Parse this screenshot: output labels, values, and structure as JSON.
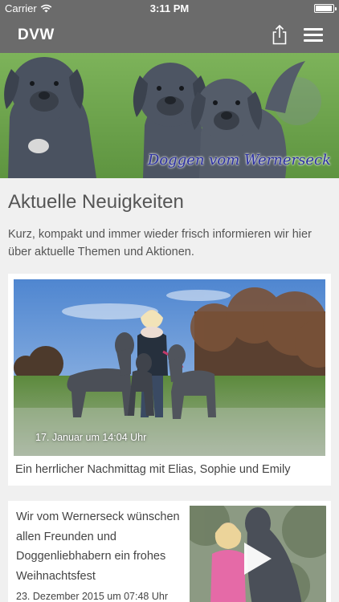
{
  "status_bar": {
    "carrier": "Carrier",
    "time": "3:11 PM",
    "battery_level": 0.95
  },
  "nav": {
    "title": "DVW",
    "share_icon": "share-icon",
    "menu_icon": "hamburger-menu-icon"
  },
  "hero": {
    "caption": "Doggen vom Wernerseck"
  },
  "news": {
    "heading": "Aktuelle Neuigkeiten",
    "intro": "Kurz, kompakt und immer wieder frisch informieren wir hier über aktuelle Themen und Aktionen."
  },
  "posts": [
    {
      "date": "17. Januar um 14:04 Uhr",
      "caption": "Ein herrlicher Nachmittag mit Elias, Sophie und Emily"
    },
    {
      "text": "Wir vom Wernerseck wünschen allen Freunden und Doggenliebhabern ein frohes Weihnachtsfest",
      "date": "23. Dezember 2015 um 07:48 Uhr",
      "icon": "play-icon"
    }
  ],
  "colors": {
    "nav_bg": "#6b6b6b",
    "page_bg": "#f0f0f0",
    "card_bg": "#ffffff",
    "caption_blue": "#2a2fa0"
  }
}
